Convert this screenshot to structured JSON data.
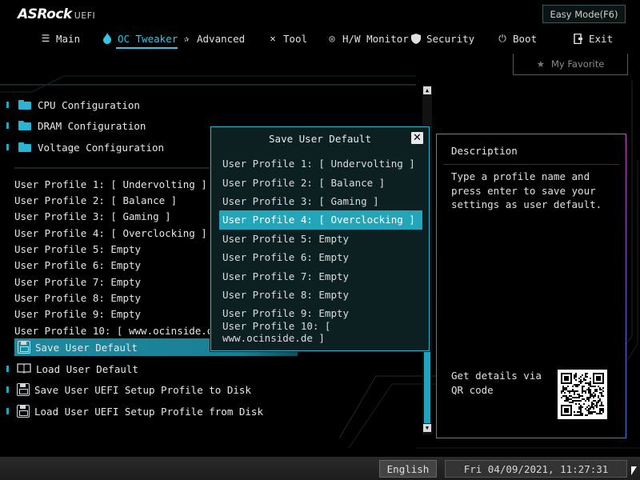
{
  "header": {
    "logo_text": "ASRock",
    "logo_suffix": "UEFI",
    "easy_mode_label": "Easy Mode(F6)"
  },
  "nav": {
    "items": [
      {
        "label": "Main",
        "icon": "list-icon"
      },
      {
        "label": "OC Tweaker",
        "icon": "flame-icon",
        "active": true
      },
      {
        "label": "Advanced",
        "icon": "star-gear-icon"
      },
      {
        "label": "Tool",
        "icon": "tools-icon"
      },
      {
        "label": "H/W Monitor",
        "icon": "monitor-icon"
      },
      {
        "label": "Security",
        "icon": "shield-icon"
      },
      {
        "label": "Boot",
        "icon": "power-icon"
      },
      {
        "label": "Exit",
        "icon": "exit-icon"
      }
    ]
  },
  "favorite": {
    "label": "My Favorite"
  },
  "left": {
    "folders": [
      {
        "label": "CPU Configuration"
      },
      {
        "label": "DRAM Configuration"
      },
      {
        "label": "Voltage Configuration"
      }
    ],
    "profiles": [
      "User Profile 1: [ Undervolting ]",
      "User Profile 2: [ Balance ]",
      "User Profile 3: [ Gaming ]",
      "User Profile 4: [ Overclocking ]",
      "User Profile 5: Empty",
      "User Profile 6: Empty",
      "User Profile 7: Empty",
      "User Profile 8: Empty",
      "User Profile 9: Empty",
      "User Profile 10: [ www.ocinside.de ]"
    ],
    "actions": [
      {
        "label": "Save User Default",
        "icon": "floppy-icon",
        "selected": true
      },
      {
        "label": "Load User Default",
        "icon": "book-icon"
      },
      {
        "label": "Save User UEFI Setup Profile to Disk",
        "icon": "floppy-icon"
      },
      {
        "label": "Load User UEFI Setup Profile from Disk",
        "icon": "floppy-icon"
      }
    ]
  },
  "dialog": {
    "title": "Save User Default",
    "close_glyph": "✕",
    "items": [
      "User Profile 1: [ Undervolting ]",
      "User Profile 2: [ Balance ]",
      "User Profile 3: [ Gaming ]",
      "User Profile 4: [ Overclocking ]",
      "User Profile 5: Empty",
      "User Profile 6: Empty",
      "User Profile 7: Empty",
      "User Profile 8: Empty",
      "User Profile 9: Empty",
      "User Profile 10: [ www.ocinside.de ]"
    ],
    "selected_index": 3
  },
  "description": {
    "title": "Description",
    "text": "Type a profile name and press enter to save your settings as user default.",
    "qr_text": "Get details via QR code"
  },
  "footer": {
    "language": "English",
    "datetime": "Fri 04/09/2021, 11:27:31"
  },
  "colors": {
    "accent": "#33c6e6",
    "selection": "#24a6ba",
    "panel_border_top": "#e03ad8",
    "panel_border_bottom": "#3a7fe8"
  }
}
